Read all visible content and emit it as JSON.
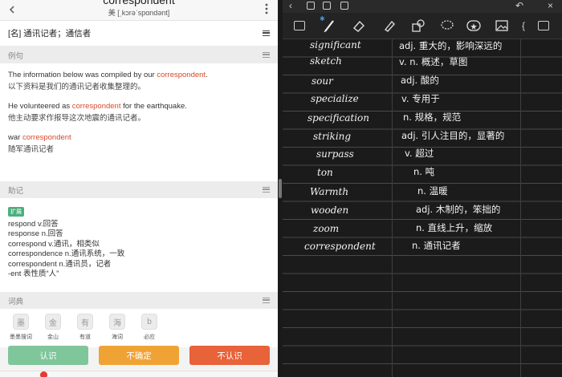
{
  "dict": {
    "word": "correspondent",
    "phonetic": "美 [ˌkɔrəˈspɑndənt]",
    "part_of_speech": "[名] 通讯记者；通信者",
    "examples_header": "例句",
    "examples": [
      {
        "en_pre": "The information below was compiled by our ",
        "en_hl": "correspondent",
        "en_post": ".",
        "zh": "以下资料是我们的通讯记者收集整理的。"
      },
      {
        "en_pre": "He volunteered as ",
        "en_hl": "correspondent",
        "en_post": " for the earthquake.",
        "zh": "他主动要求作报导这次地震的通讯记者。"
      },
      {
        "en_pre": "war ",
        "en_hl": "correspondent",
        "en_post": "",
        "zh": "随军通讯记者"
      }
    ],
    "assoc_header": "助记",
    "assoc_badge": "扩展",
    "assoc_lines": [
      "respond v.回答",
      "response n.回答",
      "correspond v.通讯，相类似",
      "correspondence n.通讯系统，一致",
      "correspondent n.通讯员，记者",
      "-ent 表性质“人”"
    ],
    "dicts_header": "词典",
    "dictionaries": [
      {
        "label": "墨墨搜词",
        "icon": "墨"
      },
      {
        "label": "金山",
        "icon": "金"
      },
      {
        "label": "有道",
        "icon": "有"
      },
      {
        "label": "海词",
        "icon": "海"
      },
      {
        "label": "必应",
        "icon": "b"
      }
    ],
    "buttons": {
      "know": "认识",
      "unsure": "不确定",
      "unknown": "不认识"
    },
    "colors": {
      "highlight": "#d9482b",
      "know": "#7fc69b",
      "unsure": "#f0a335",
      "unknown": "#e8623a"
    }
  },
  "notes": {
    "rows": [
      {
        "word": "significant",
        "meaning": "adj. 重大的，影响深远的"
      },
      {
        "word": "sketch",
        "meaning": "v. n. 概述，草图"
      },
      {
        "word": "sour",
        "meaning": "adj. 酸的"
      },
      {
        "word": "specialize",
        "meaning": "v. 专用于"
      },
      {
        "word": "specification",
        "meaning": "n. 规格，规范"
      },
      {
        "word": "striking",
        "meaning": "adj. 引人注目的，显著的"
      },
      {
        "word": "surpass",
        "meaning": "v. 超过"
      },
      {
        "word": "ton",
        "meaning": "n. 吨"
      },
      {
        "word": "Warmth",
        "meaning": "n. 温暖"
      },
      {
        "word": "wooden",
        "meaning": "adj. 木制的，笨拙的"
      },
      {
        "word": "zoom",
        "meaning": "n. 直线上升，缩放"
      },
      {
        "word": "correspondent",
        "meaning": "n. 通讯记者"
      }
    ]
  }
}
